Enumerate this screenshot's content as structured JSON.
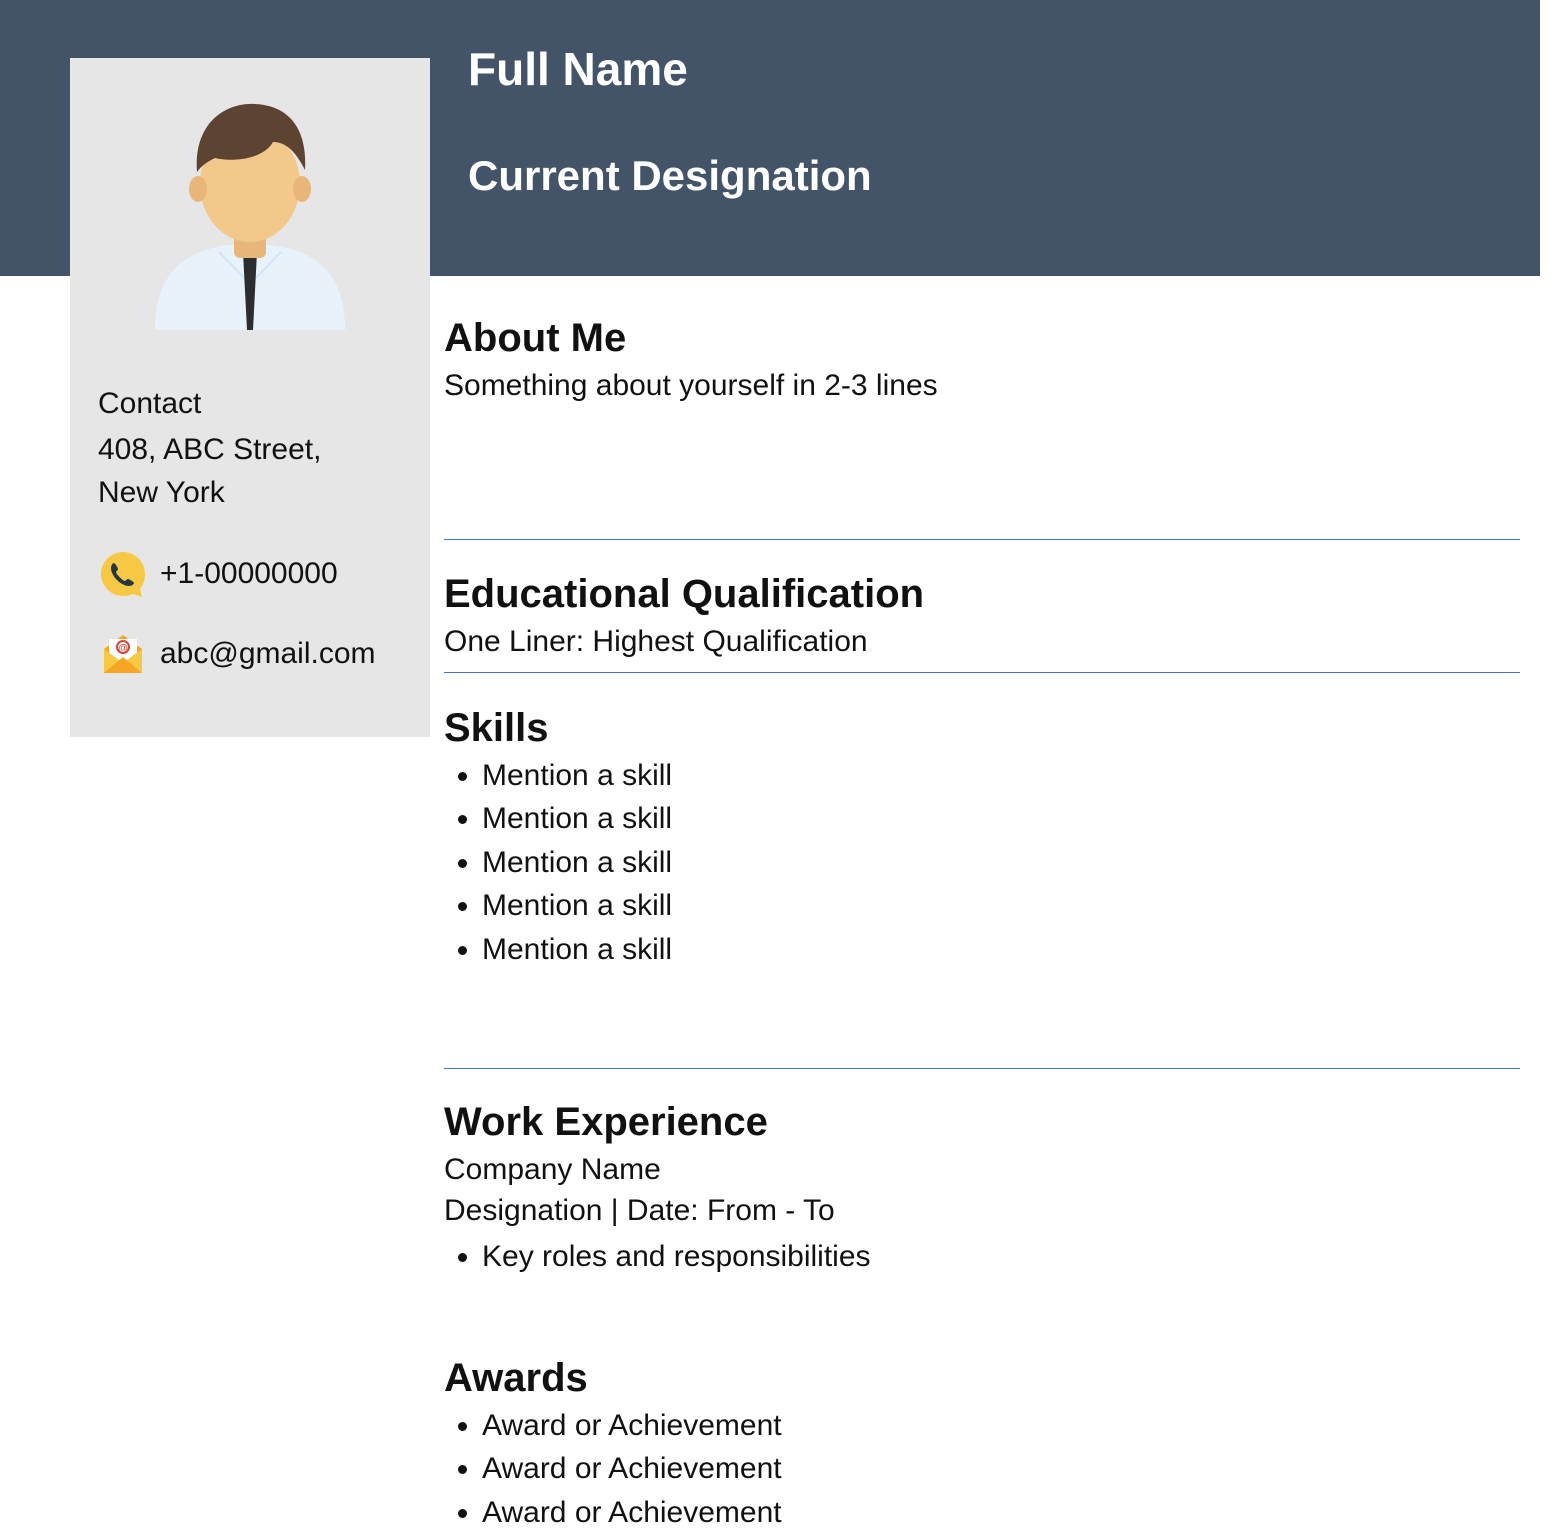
{
  "header": {
    "name": "Full Name",
    "designation": "Current Designation"
  },
  "contact": {
    "heading": "Contact",
    "address": "408, ABC Street,\nNew York",
    "phone": "+1-00000000",
    "email": "abc@gmail.com"
  },
  "sections": {
    "about": {
      "title": "About Me",
      "body": "Something about yourself in 2-3 lines"
    },
    "education": {
      "title": "Educational Qualification",
      "body": "One Liner: Highest Qualification"
    },
    "skills": {
      "title": "Skills",
      "items": [
        "Mention a skill",
        "Mention a skill",
        "Mention a skill",
        "Mention a skill",
        "Mention a skill"
      ]
    },
    "work": {
      "title": "Work Experience",
      "line1": "Company Name",
      "line2": "Designation | Date: From - To",
      "bullet": "Key roles and responsibilities"
    },
    "awards": {
      "title": "Awards",
      "items": [
        "Award or Achievement",
        "Award or Achievement",
        "Award or Achievement"
      ]
    }
  }
}
